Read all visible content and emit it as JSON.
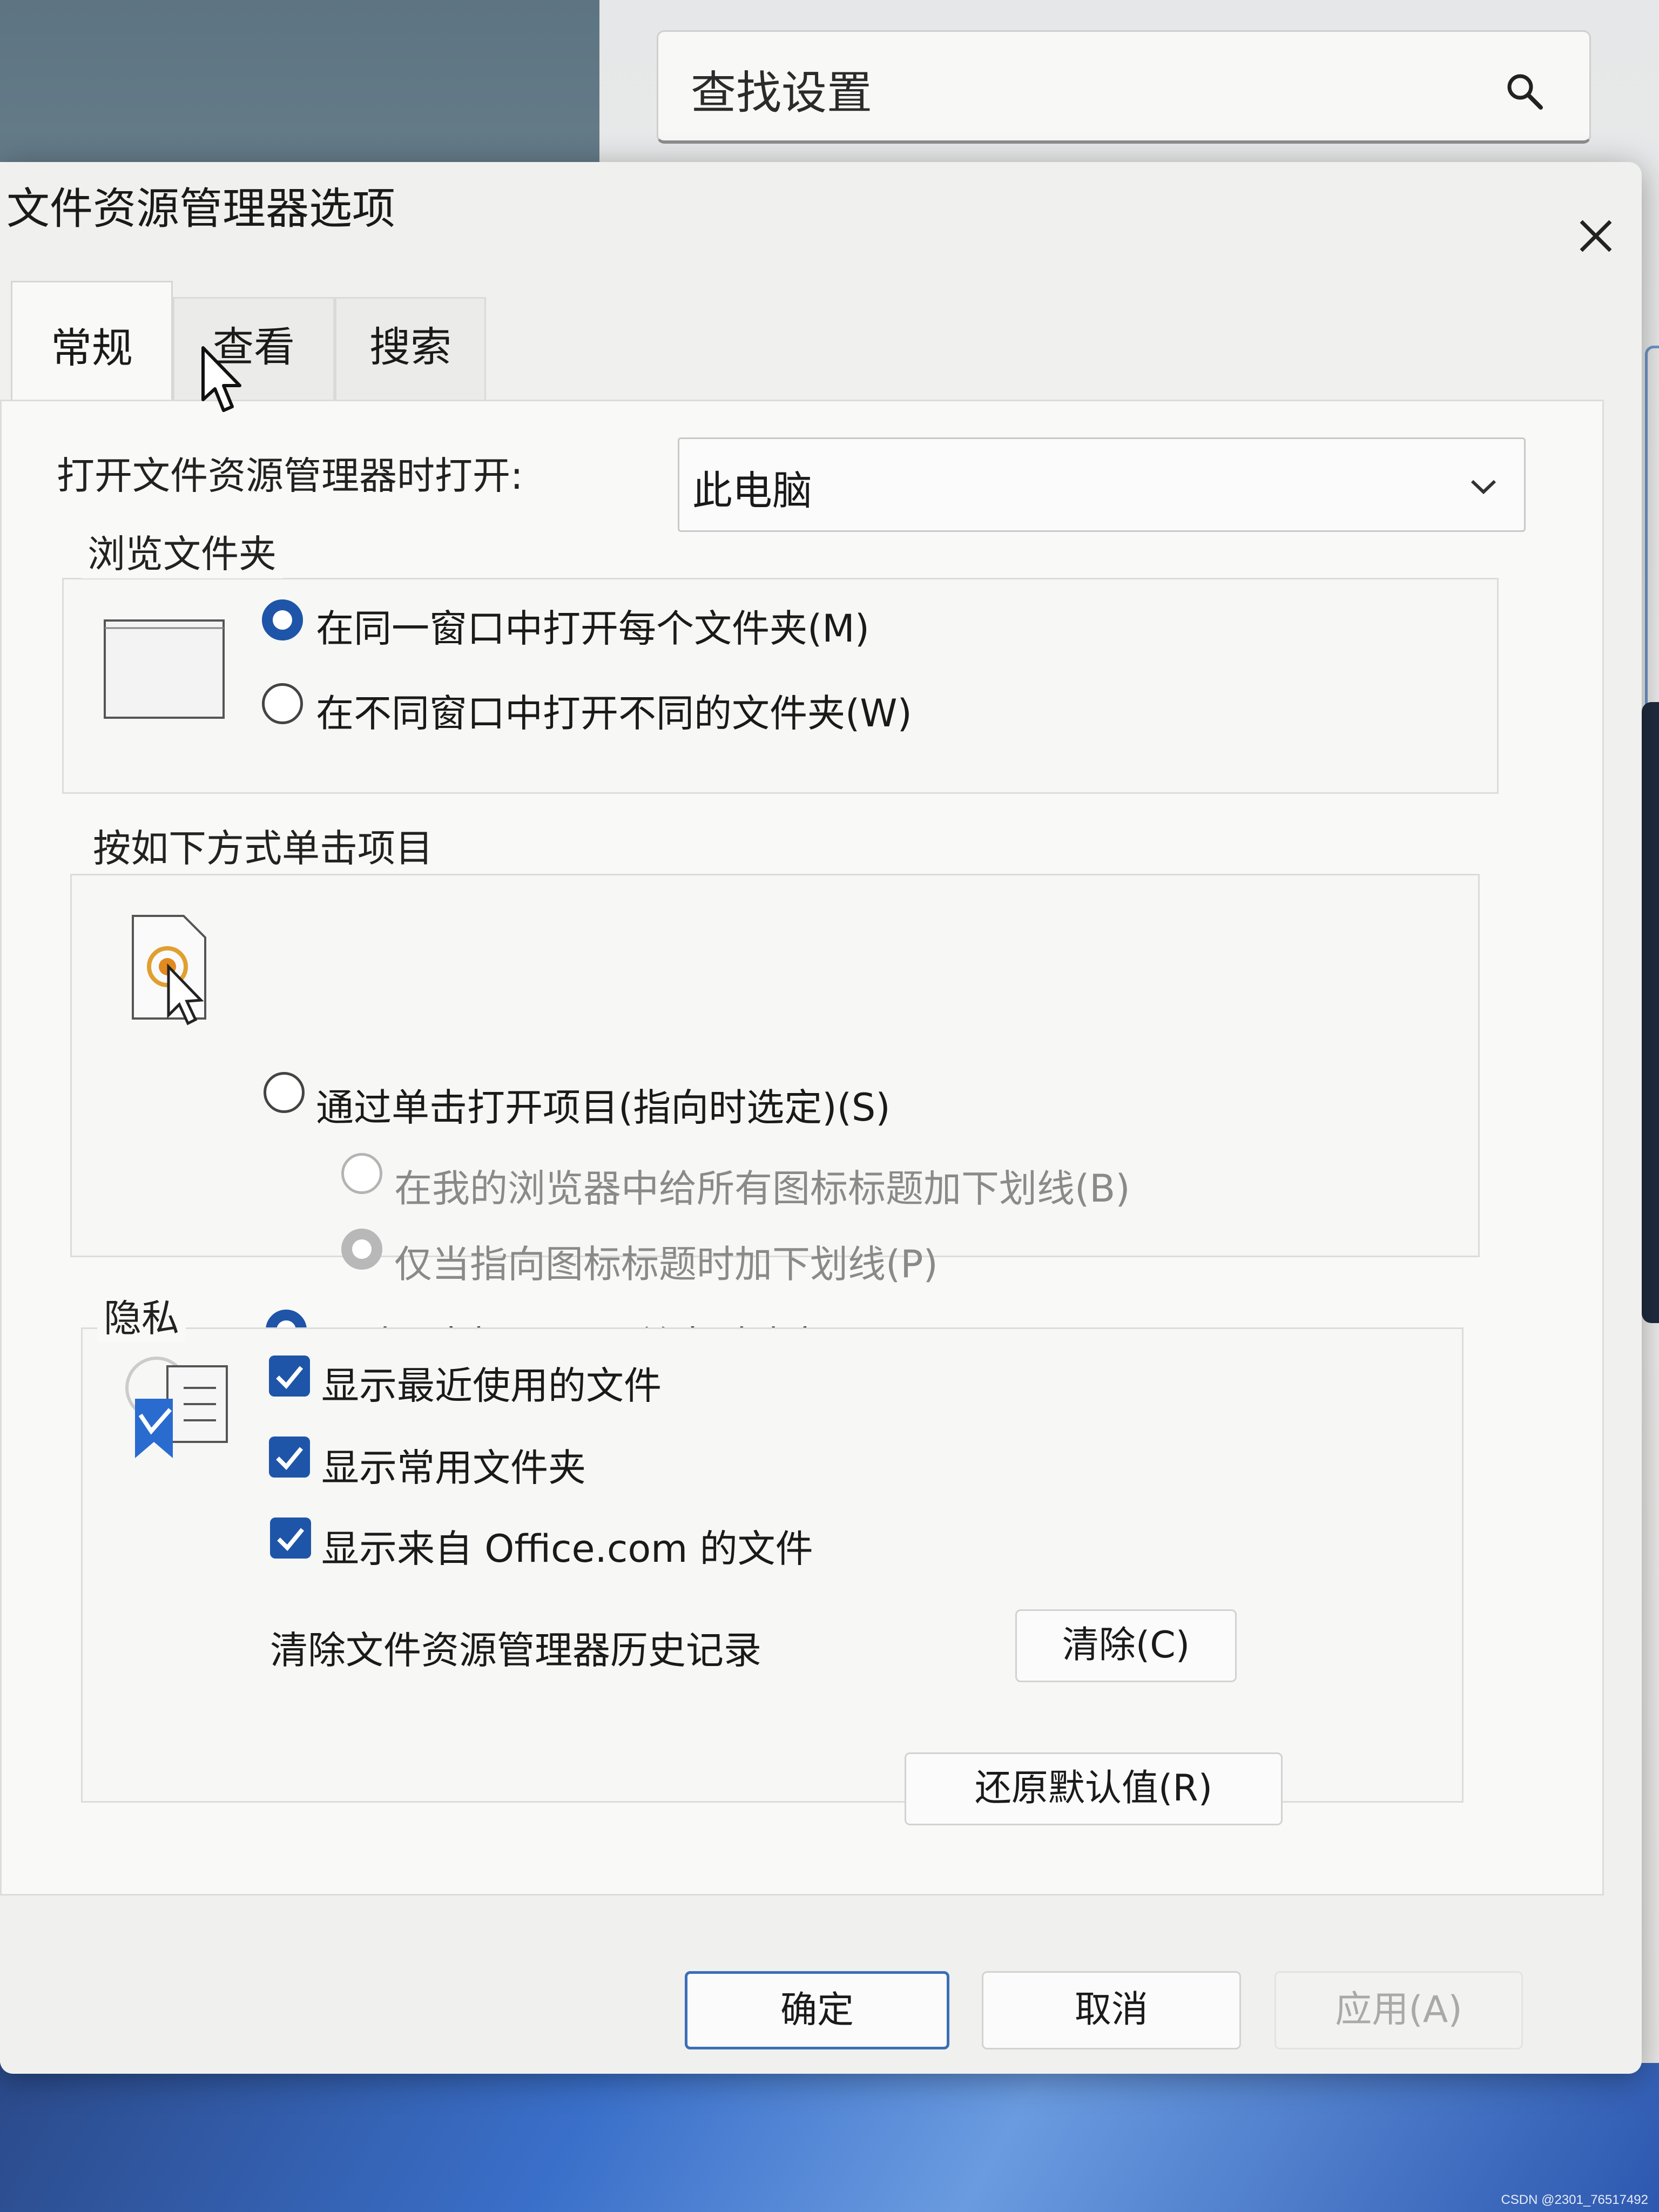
{
  "settings_window": {
    "search_placeholder": "查找设置"
  },
  "dialog": {
    "title": "文件资源管理器选项",
    "tabs": [
      {
        "label": "常规",
        "active": true
      },
      {
        "label": "查看",
        "active": false
      },
      {
        "label": "搜索",
        "active": false
      }
    ],
    "open_label": "打开文件资源管理器时打开:",
    "open_value": "此电脑",
    "browse": {
      "title": "浏览文件夹",
      "options": [
        {
          "label": "在同一窗口中打开每个文件夹(M)",
          "selected": true
        },
        {
          "label": "在不同窗口中打开不同的文件夹(W)",
          "selected": false
        }
      ]
    },
    "click": {
      "title": "按如下方式单击项目",
      "options": [
        {
          "label": "通过单击打开项目(指向时选定)(S)",
          "selected": false,
          "enabled": true
        },
        {
          "label": "在我的浏览器中给所有图标标题加下划线(B)",
          "selected": false,
          "enabled": false
        },
        {
          "label": "仅当指向图标标题时加下划线(P)",
          "selected": true,
          "enabled": false
        },
        {
          "label": "通过双击打开项目(单击时选定)(D)",
          "selected": true,
          "enabled": true
        }
      ]
    },
    "privacy": {
      "title": "隐私",
      "checks": [
        {
          "label": "显示最近使用的文件",
          "checked": true
        },
        {
          "label": "显示常用文件夹",
          "checked": true
        },
        {
          "label": "显示来自 Office.com 的文件",
          "checked": true
        }
      ],
      "clear_label": "清除文件资源管理器历史记录",
      "clear_button": "清除(C)"
    },
    "restore_button": "还原默认值(R)",
    "ok_button": "确定",
    "cancel_button": "取消",
    "apply_button": "应用(A)"
  },
  "watermark": "CSDN @2301_76517492",
  "colors": {
    "accent": "#1e55a8",
    "dialog_bg": "#f0f0ef",
    "panel_bg": "#f9f9f8"
  }
}
